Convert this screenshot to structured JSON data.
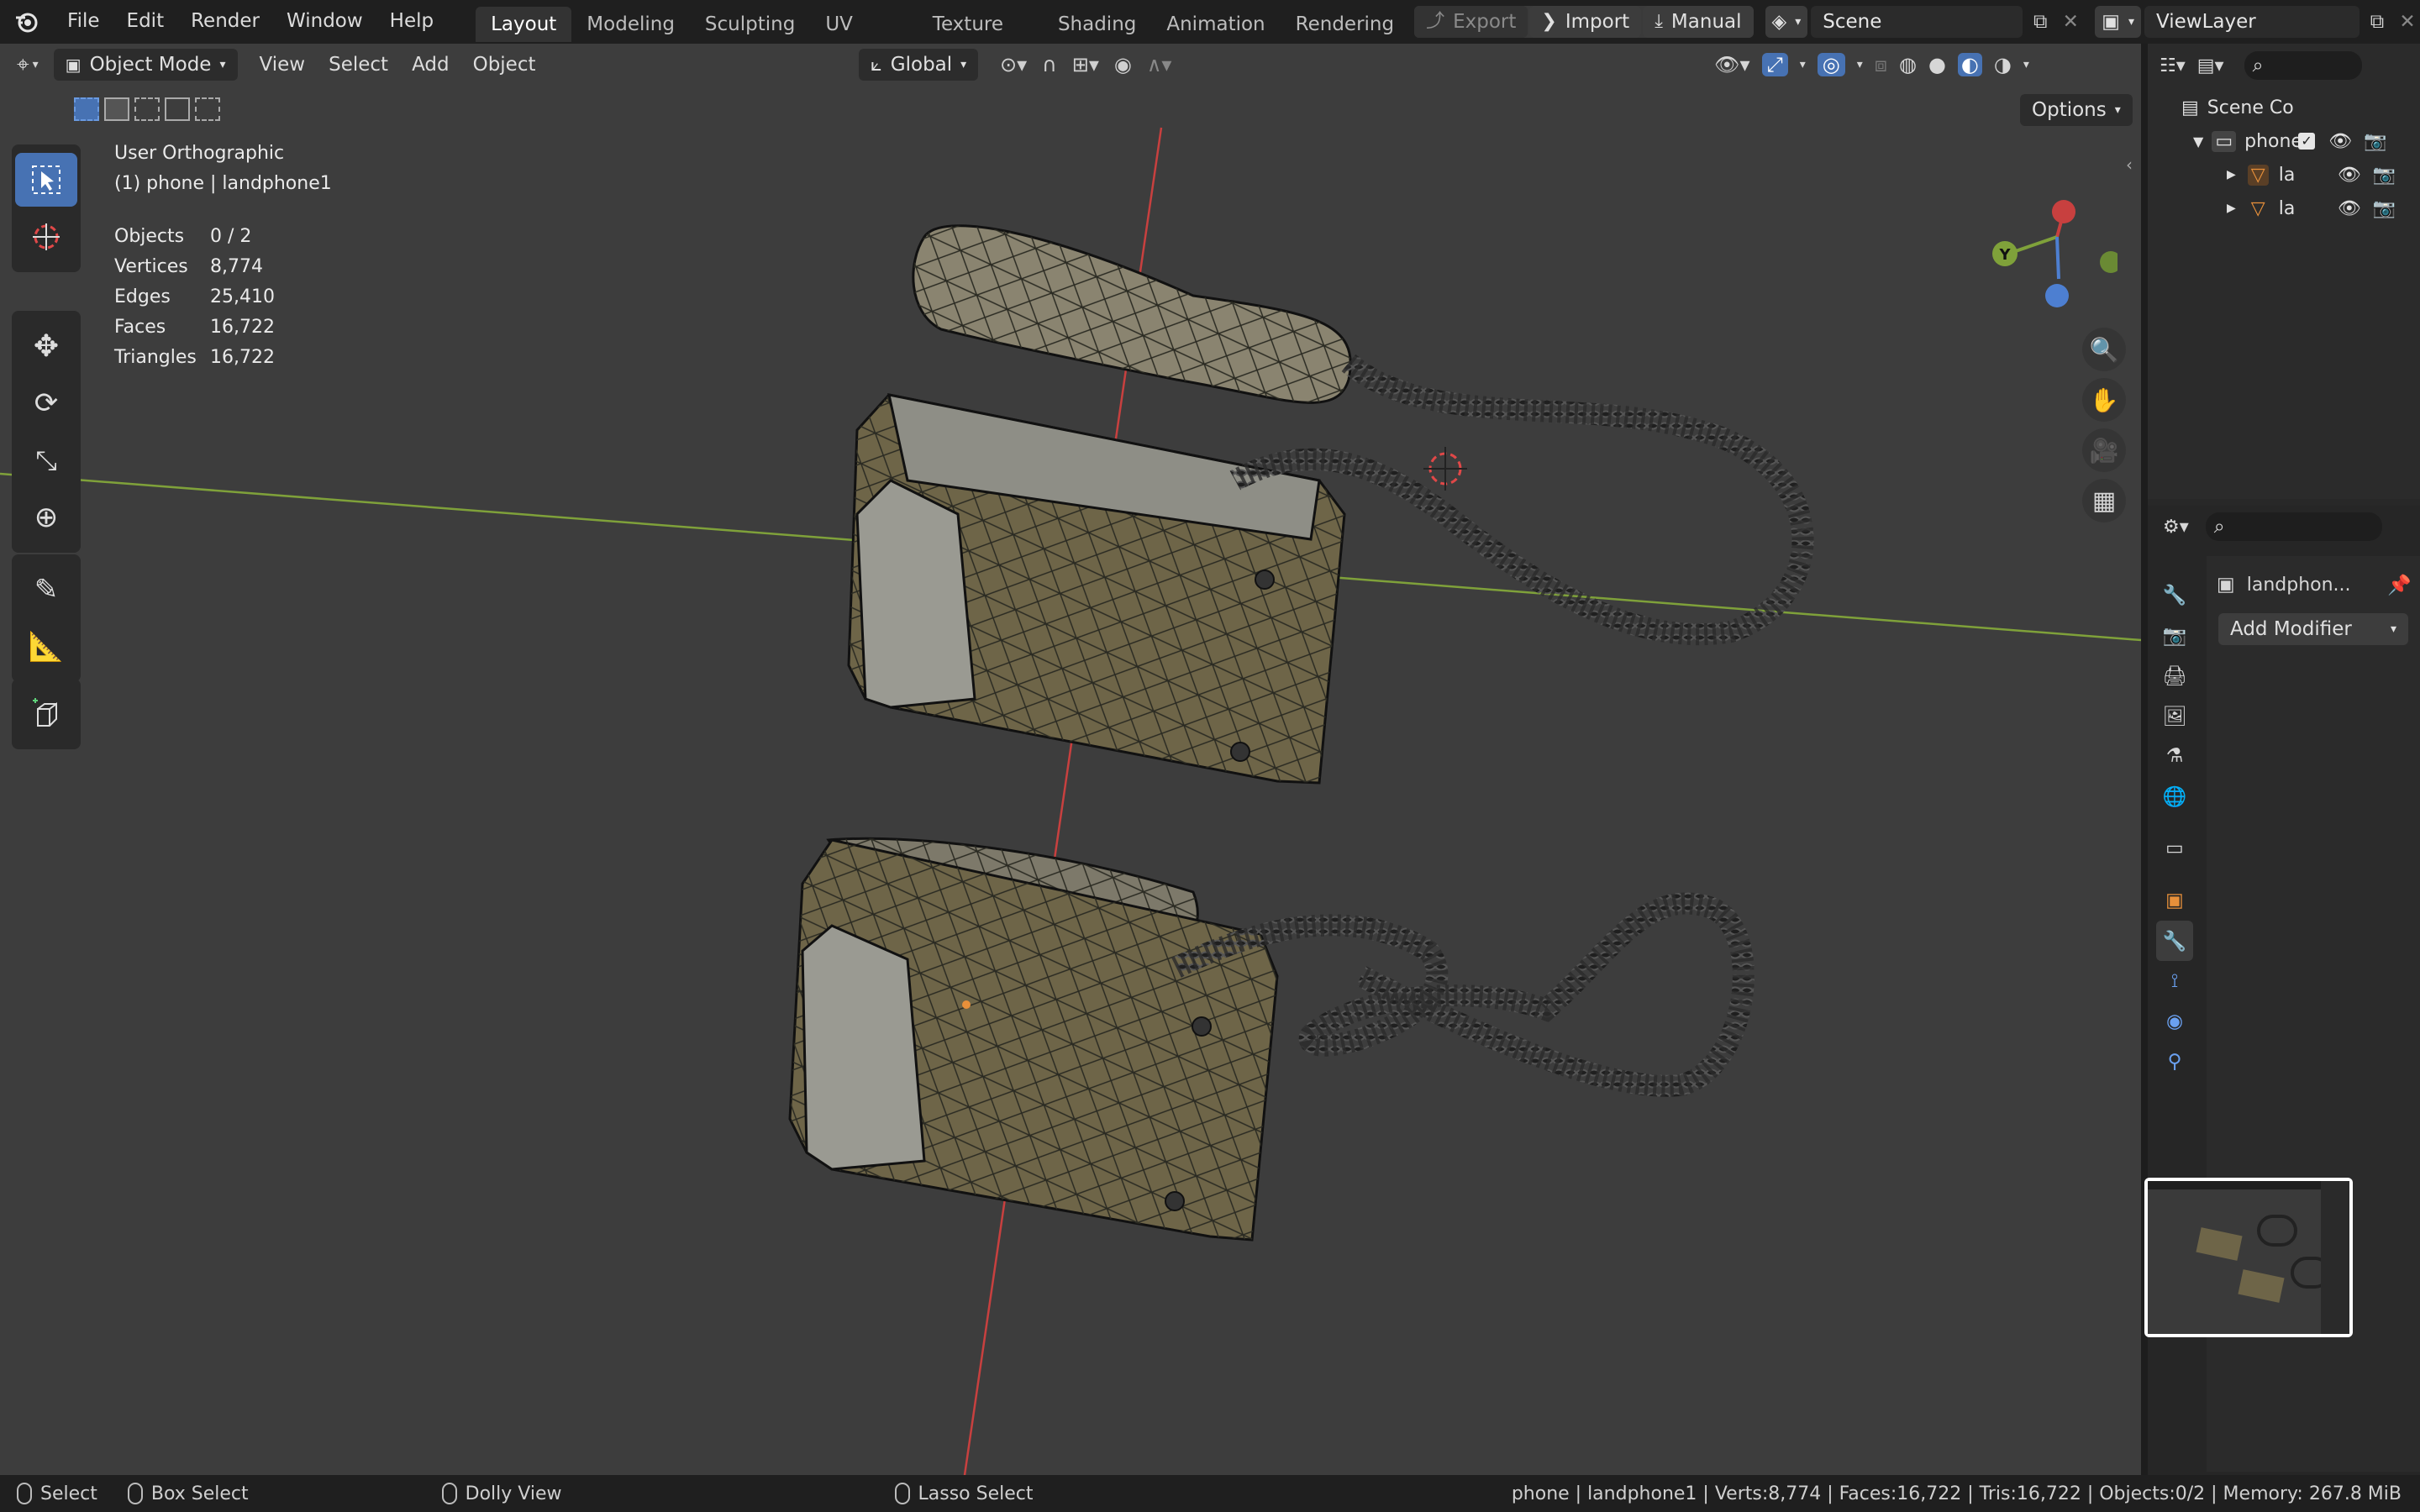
{
  "topbar": {
    "menus": [
      "File",
      "Edit",
      "Render",
      "Window",
      "Help"
    ],
    "workspaces": [
      "Layout",
      "Modeling",
      "Sculpting",
      "UV Editing",
      "Texture Paint",
      "Shading",
      "Animation",
      "Rendering"
    ],
    "export_label": "Export",
    "import_label": "Import",
    "manual_label": "Manual",
    "scene_name": "Scene",
    "view_layer": "ViewLayer"
  },
  "viewport_header": {
    "mode": "Object Mode",
    "menus": [
      "View",
      "Select",
      "Add",
      "Object"
    ],
    "orientation": "Global",
    "options_label": "Options"
  },
  "viewport": {
    "view_name": "User Orthographic",
    "context": "(1) phone | landphone1",
    "stats": [
      {
        "label": "Objects",
        "value": "0 / 2"
      },
      {
        "label": "Vertices",
        "value": "8,774"
      },
      {
        "label": "Edges",
        "value": "25,410"
      },
      {
        "label": "Faces",
        "value": "16,722"
      },
      {
        "label": "Triangles",
        "value": "16,722"
      }
    ],
    "gizmo_y_label": "Y"
  },
  "outliner": {
    "rows": [
      {
        "label": "Scene Co"
      },
      {
        "label": "phone"
      },
      {
        "label": "la"
      },
      {
        "label": "la"
      }
    ]
  },
  "properties": {
    "object_name": "landphon...",
    "add_modifier_label": "Add Modifier"
  },
  "statusbar": {
    "hints": [
      "Select",
      "Box Select",
      "Dolly View",
      "Lasso Select"
    ],
    "info": "phone | landphone1 | Verts:8,774 | Faces:16,722 | Tris:16,722 | Objects:0/2 | Memory: 267.8 MiB"
  },
  "colors": {
    "accent": "#4772b3",
    "viewport_bg": "#3d3d3d",
    "x_axis": "#c8403f",
    "y_axis": "#7fa13a",
    "object_orange": "#e8903a"
  }
}
